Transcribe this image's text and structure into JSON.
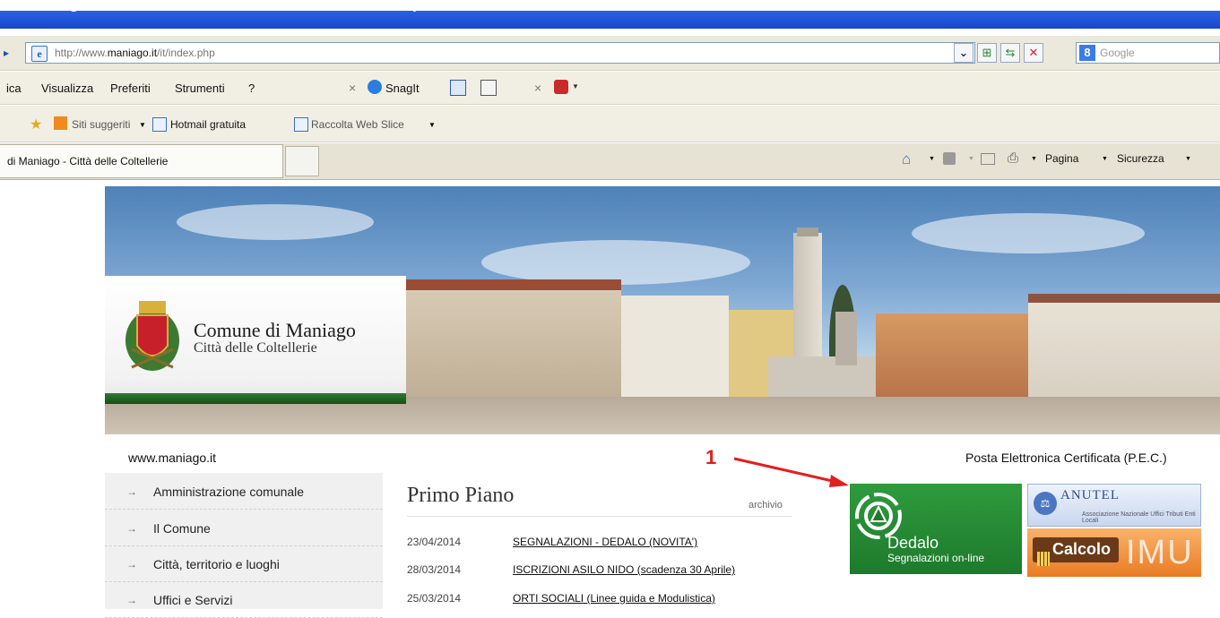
{
  "browser": {
    "title": "- di Maniago - Città delle Coltellerie - Windows Internet Explorer",
    "url_prefix": "http://www.",
    "url_domain": "maniago.it",
    "url_path": "/it/index.php",
    "search_placeholder": "Google",
    "menu": [
      "ica",
      "Visualizza",
      "Preferiti",
      "Strumenti",
      "?"
    ],
    "toolbar_snagit": "SnagIt",
    "favorites": [
      "Siti suggeriti",
      "Hotmail gratuita",
      "Raccolta Web Slice"
    ],
    "tab_title": "di Maniago - Città delle Coltellerie",
    "commands": [
      "Pagina",
      "Sicurezza"
    ]
  },
  "page": {
    "logo_title": "Comune di Maniago",
    "logo_subtitle": "Città delle Coltellerie",
    "site_label": "www.maniago.it",
    "pec_label": "Posta Elettronica Certificata (P.E.C.)",
    "nav_items": [
      "Amministrazione comunale",
      "Il Comune",
      "Città, territorio e luoghi",
      "Uffici e Servizi"
    ],
    "primo_piano": "Primo Piano",
    "archivio": "archivio",
    "news": [
      {
        "date": "23/04/2014",
        "title": "SEGNALAZIONI - DEDALO (NOVITA')"
      },
      {
        "date": "28/03/2014",
        "title": "ISCRIZIONI ASILO NIDO (scadenza 30 Aprile)"
      },
      {
        "date": "25/03/2014",
        "title": "ORTI SOCIALI (Linee guida e Modulistica)"
      }
    ],
    "annotation_number": "1",
    "dedalo_title": "Dedalo",
    "dedalo_subtitle": "Segnalazioni on-line",
    "anutel_title": "ANUTEL",
    "anutel_sub": "Associazione Nazionale Uffici Tributi Enti Locali",
    "calcolo": "Calcolo",
    "imu": "IMU"
  }
}
